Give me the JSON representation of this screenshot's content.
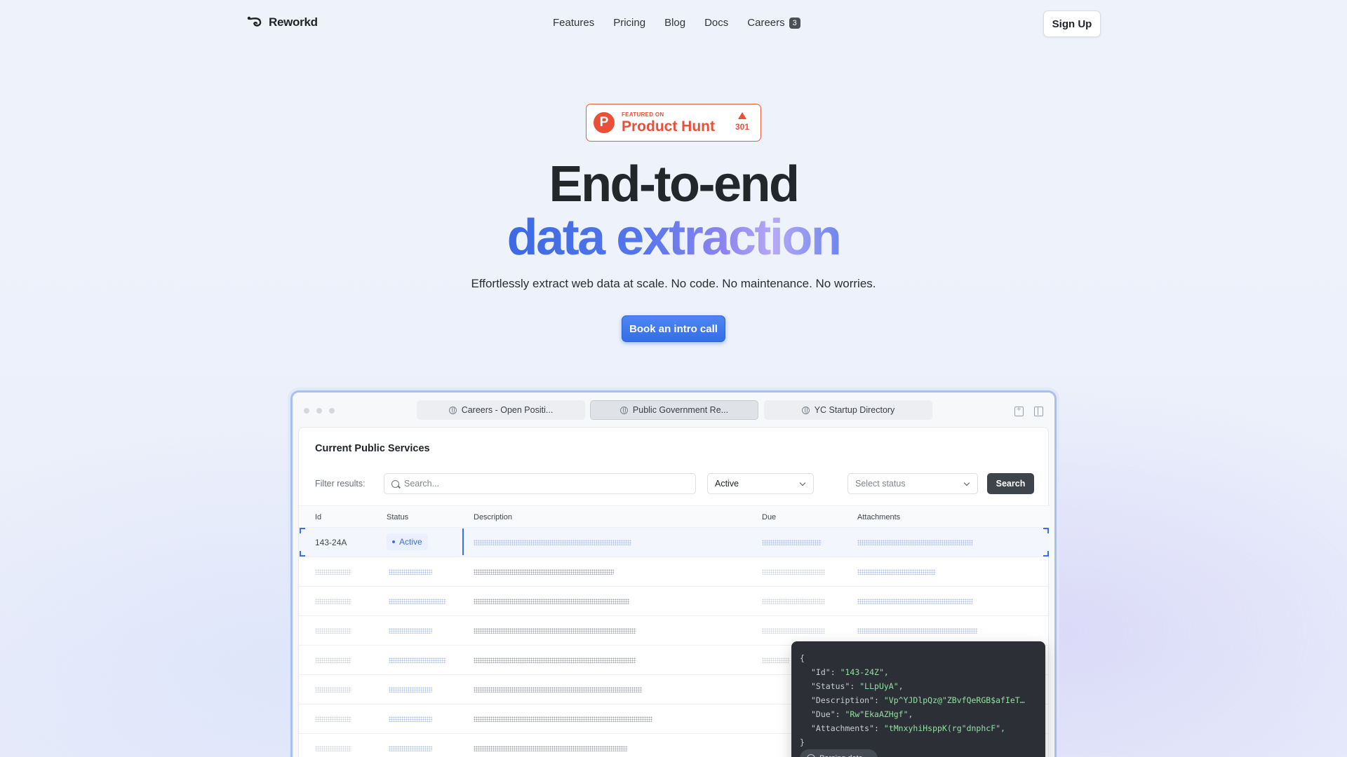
{
  "nav": {
    "brand": "Reworkd",
    "items": [
      {
        "label": "Features"
      },
      {
        "label": "Pricing"
      },
      {
        "label": "Blog"
      },
      {
        "label": "Docs"
      },
      {
        "label": "Careers",
        "badge": "3"
      }
    ],
    "signup": "Sign Up"
  },
  "producthunt": {
    "featured": "FEATURED ON",
    "name": "Product Hunt",
    "votes": "301"
  },
  "hero": {
    "line1": "End-to-end",
    "line2": "data extraction",
    "subtitle": "Effortlessly extract web data at scale. No code. No maintenance. No worries.",
    "cta": "Book an intro call"
  },
  "browser": {
    "tabs": [
      {
        "label": "Careers - Open Positi..."
      },
      {
        "label": "Public Government Re..."
      },
      {
        "label": "YC Startup Directory"
      }
    ],
    "panel": {
      "title": "Current Public Services",
      "filter_label": "Filter results:",
      "search_placeholder": "Search...",
      "status_value": "Active",
      "status_placeholder": "Select status",
      "search_button": "Search",
      "columns": [
        "Id",
        "Status",
        "Description",
        "Due",
        "Attachments"
      ],
      "first_row": {
        "id": "143-24A",
        "status": "Active"
      },
      "faded_status": "Active"
    }
  },
  "json_popup": {
    "open": "{",
    "close": "}",
    "lines": [
      {
        "key": "\"Id\"",
        "value": "\"143-24Z\","
      },
      {
        "key": "\"Status\"",
        "value": "\"LLpUyA\","
      },
      {
        "key": "\"Description\"",
        "value": "\"Vp^YJDlpQz@\"ZBvfQeRGB$afIeT…"
      },
      {
        "key": "\"Due\"",
        "value": "\"Rw\"EkaAZHgf\","
      },
      {
        "key": "\"Attachments\"",
        "value": "\"tMnxyhiHsppK(rg\"dnphcF\","
      }
    ],
    "parsing": "Parsing data..."
  },
  "colors": {
    "accent": "#3e6fe0",
    "cta": "#336ee6",
    "producthunt": "#e8503a",
    "json_bg": "#2c3036",
    "json_value": "#8fe0a0"
  }
}
